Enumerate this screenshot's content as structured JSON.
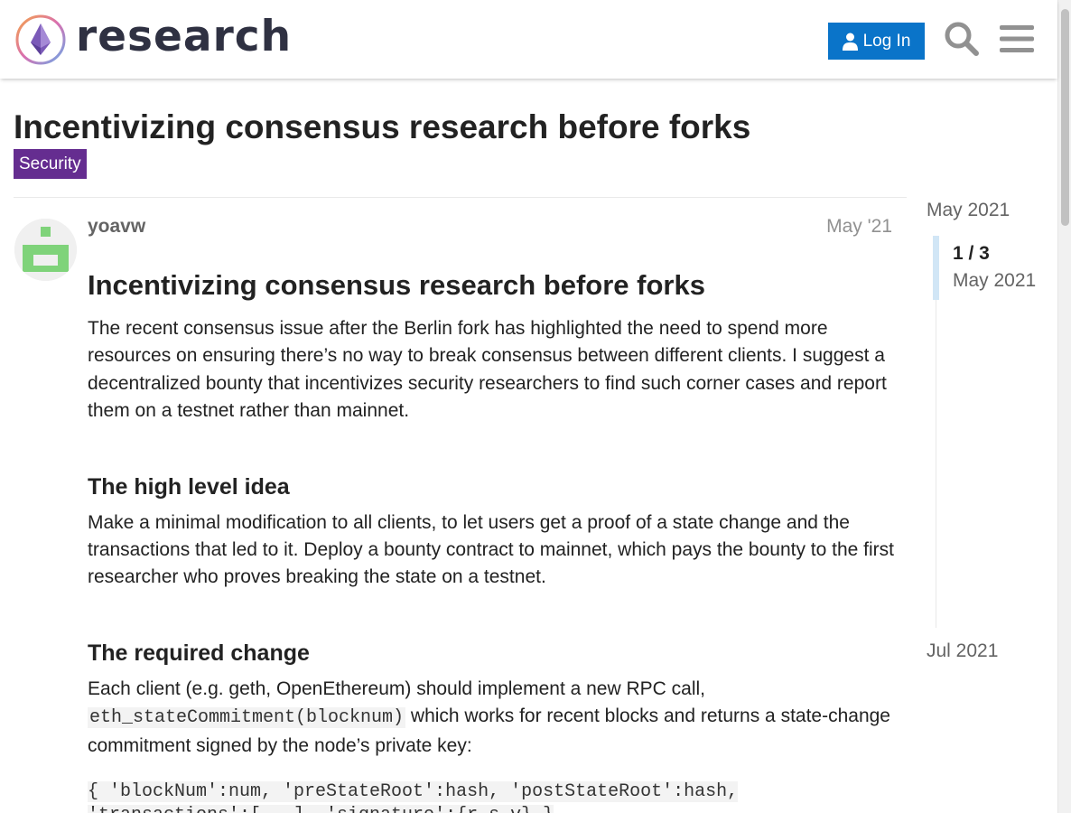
{
  "header": {
    "brand": "research",
    "login_label": "Log In"
  },
  "topic": {
    "title": "Incentivizing consensus research before forks",
    "category": "Security",
    "category_color": "#652d90"
  },
  "post": {
    "username": "yoavw",
    "date": "May '21",
    "heading": "Incentivizing consensus research before forks",
    "intro": "The recent consensus issue after the Berlin fork has highlighted the need to spend more resources on ensuring there’s no way to break consensus between different clients. I suggest a decentralized bounty that incentivizes security researchers to find such corner cases and report them on a testnet rather than mainnet.",
    "section1_title": "The high level idea",
    "section1_text": "Make a minimal modification to all clients, to let users get a proof of a state change and the transactions that led to it. Deploy a bounty contract to mainnet, which pays the bounty to the first researcher who proves breaking the state on a testnet.",
    "section2_title": "The required change",
    "section2_text_before": "Each client (e.g. geth, OpenEthereum) should implement a new RPC call,",
    "section2_code": "eth_stateCommitment(blocknum)",
    "section2_text_after": " which works for recent blocks and returns a state-change commitment signed by the node’s private key:",
    "code_line1": "{ 'blockNum':num, 'preStateRoot':hash, 'postStateRoot':hash,",
    "code_line2": "'transactions':[...], 'signature':{r,s,v} }"
  },
  "timeline": {
    "top_label": "May 2021",
    "count": "1 / 3",
    "current_date": "May 2021",
    "bottom_label": "Jul 2021"
  },
  "colors": {
    "accent": "#0a74c9",
    "timeline_handle": "#d1e6f6"
  }
}
